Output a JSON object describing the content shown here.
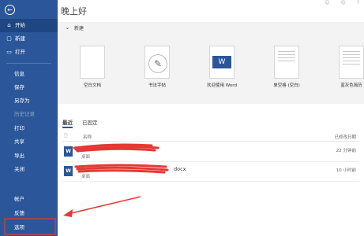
{
  "sidebar": {
    "back_glyph": "←",
    "primary": [
      {
        "icon": "home-icon",
        "glyph": "⌂",
        "label": "开始"
      },
      {
        "icon": "new-doc-icon",
        "glyph": "▢",
        "label": "新建"
      },
      {
        "icon": "folder-open-icon",
        "glyph": "▭",
        "label": "打开"
      }
    ],
    "secondary": [
      "信息",
      "保存",
      "另存为",
      "历史记录",
      "打印",
      "共享",
      "导出",
      "关闭"
    ],
    "bottom": [
      "帐户",
      "反馈",
      "选项"
    ]
  },
  "main": {
    "greeting": "晚上好",
    "new_section": {
      "heading": "新建",
      "templates": [
        {
          "label": "空白文档"
        },
        {
          "label": "书法字帖"
        },
        {
          "label": "欢迎使用 Word",
          "banner": "W"
        },
        {
          "label": "单空格 (空白)"
        },
        {
          "label": "蓝灰色简历"
        }
      ]
    },
    "tabs": [
      "最近",
      "已固定"
    ],
    "list": {
      "col_name": "名称",
      "col_date": "已修改日期",
      "files": [
        {
          "name": "",
          "location": "桌面",
          "modified": "22 分钟前"
        },
        {
          "name": "docx",
          "location": "桌面",
          "modified": "10 小时前"
        }
      ]
    }
  },
  "colors": {
    "sidebar": "#2b579a",
    "annotation": "#e53935"
  }
}
